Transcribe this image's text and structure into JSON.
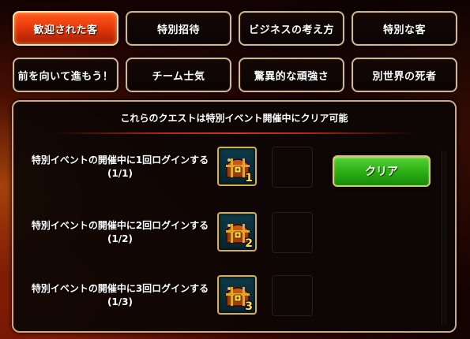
{
  "tabs": [
    {
      "label": "歓迎された客",
      "active": true
    },
    {
      "label": "特別招待",
      "active": false
    },
    {
      "label": "ビジネスの考え方",
      "active": false
    },
    {
      "label": "特別な客",
      "active": false
    },
    {
      "label": "前を向いて進もう！",
      "active": false
    },
    {
      "label": "チーム士気",
      "active": false
    },
    {
      "label": "驚異的な頑強さ",
      "active": false
    },
    {
      "label": "別世界の死者",
      "active": false
    }
  ],
  "panel": {
    "header": "これらのクエストは特別イベント開催中にクリア可能",
    "claim_label": "クリア"
  },
  "quests": [
    {
      "description": "特別イベントの開催中に1回ログインする",
      "progress": "(1/1)",
      "reward_icon": "treasure-chest-icon",
      "reward_count": "1"
    },
    {
      "description": "特別イベントの開催中に2回ログインする",
      "progress": "(1/2)",
      "reward_icon": "treasure-chest-icon",
      "reward_count": "2"
    },
    {
      "description": "特別イベントの開催中に3回ログインする",
      "progress": "(1/3)",
      "reward_icon": "treasure-chest-icon",
      "reward_count": "3"
    }
  ],
  "colors": {
    "active_tab": "#e83a0a",
    "claim_button": "#2fb517",
    "reward_count": "#ffe04a",
    "divider": "#b02a0c"
  }
}
